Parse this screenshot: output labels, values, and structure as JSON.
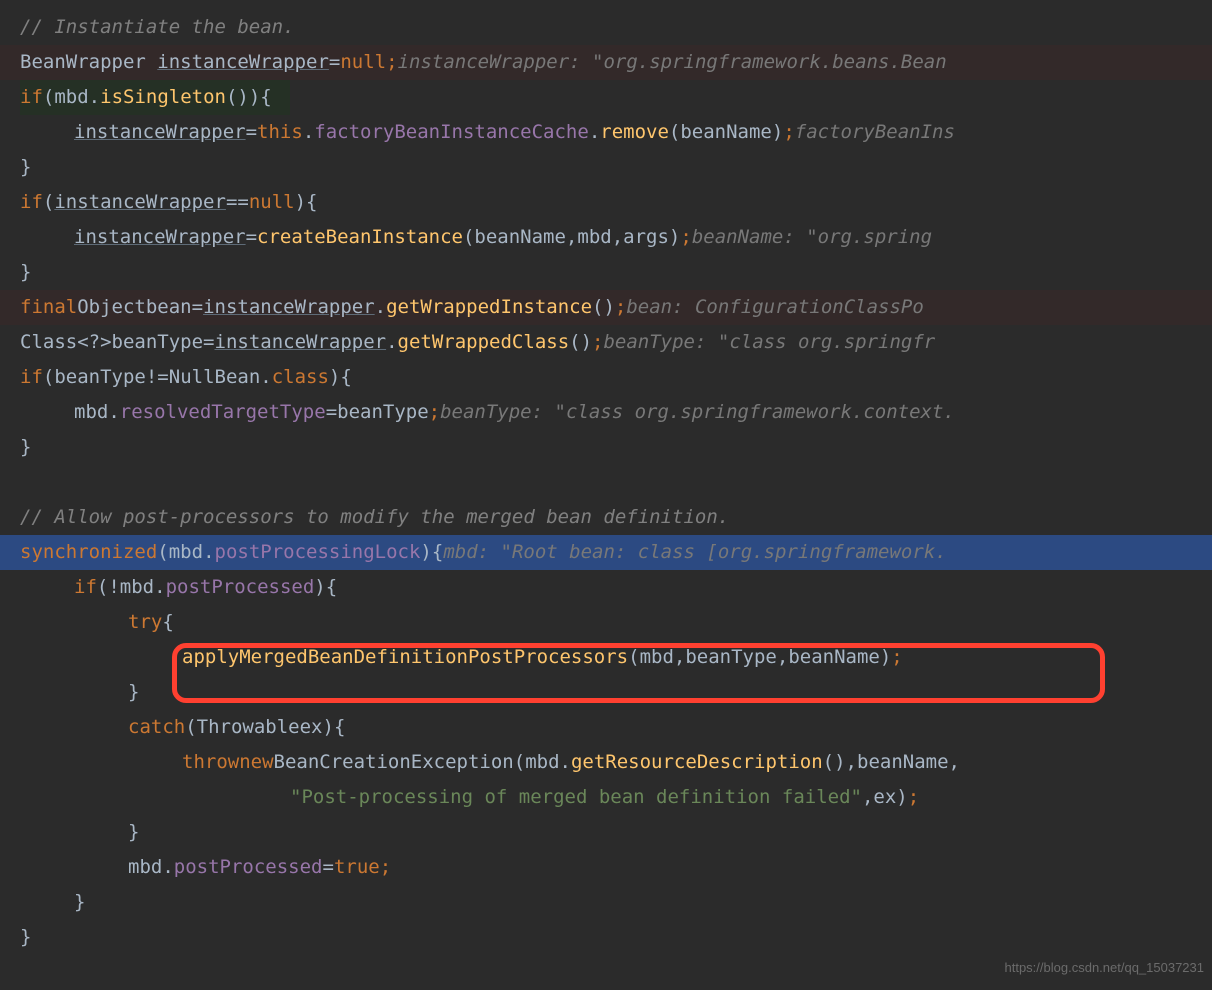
{
  "watermark": "https://blog.csdn.net/qq_15037231",
  "lines": {
    "l1": {
      "comment": "// Instantiate the bean."
    },
    "l2": {
      "type": "BeanWrapper",
      "var": "instanceWrapper",
      "eq": " = ",
      "null": "null",
      "semi": ";",
      "inlay": "   instanceWrapper: \"org.springframework.beans.Bean"
    },
    "l3": {
      "if": "if ",
      "po": "(",
      "obj": "mbd",
      "dot": ".",
      "method": "isSingleton",
      "pc": "()) ",
      "brace": "{"
    },
    "l4": {
      "var": "instanceWrapper",
      "eq": " = ",
      "this": "this",
      "dot": ".",
      "prop": "factoryBeanInstanceCache",
      "dot2": ".",
      "method": "remove",
      "po": "(",
      "arg": "beanName",
      "pc": ")",
      "semi": ";",
      "inlay": "   factoryBeanIns"
    },
    "l5": {
      "brace": "}"
    },
    "l6": {
      "if": "if ",
      "po": "(",
      "var": "instanceWrapper",
      "eq": " == ",
      "null": "null",
      "pc": ") ",
      "brace": "{"
    },
    "l7": {
      "var": "instanceWrapper",
      "eq": " = ",
      "method": "createBeanInstance",
      "po": "(",
      "arg1": "beanName",
      "c1": ", ",
      "arg2": "mbd",
      "c2": ", ",
      "arg3": "args",
      "pc": ")",
      "semi": ";",
      "inlay": "   beanName: \"org.spring"
    },
    "l8": {
      "brace": "}"
    },
    "l9": {
      "final": "final ",
      "type": "Object ",
      "var": "bean",
      "eq": " = ",
      "var2": "instanceWrapper",
      "dot": ".",
      "method": "getWrappedInstance",
      "pc": "()",
      "semi": ";",
      "inlay": "   bean: ConfigurationClassPo"
    },
    "l10": {
      "type": "Class",
      "gen": "<?> ",
      "var": "beanType",
      "eq": " = ",
      "var2": "instanceWrapper",
      "dot": ".",
      "method": "getWrappedClass",
      "pc": "()",
      "semi": ";",
      "inlay": "   beanType: \"class org.springfr"
    },
    "l11": {
      "if": "if ",
      "po": "(",
      "var": "beanType",
      "neq": " != ",
      "type": "NullBean",
      "dot": ".",
      "cls": "class",
      "pc": ") ",
      "brace": "{"
    },
    "l12": {
      "obj": "mbd",
      "dot": ".",
      "prop": "resolvedTargetType",
      "eq": " = ",
      "var": "beanType",
      "semi": ";",
      "inlay": "   beanType: \"class org.springframework.context."
    },
    "l13": {
      "brace": "}"
    },
    "l14": {
      "empty": ""
    },
    "l15": {
      "comment": "// Allow post-processors to modify the merged bean definition."
    },
    "l16": {
      "sync": "synchronized ",
      "po": "(",
      "obj": "mbd",
      "dot": ".",
      "prop": "postProcessingLock",
      "pc": ") ",
      "brace": "{",
      "inlay": "   mbd: \"Root bean: class [org.springframework."
    },
    "l17": {
      "if": "if ",
      "po": "(",
      "not": "!",
      "obj": "mbd",
      "dot": ".",
      "prop": "postProcessed",
      "pc": ") ",
      "brace": "{"
    },
    "l18": {
      "try": "try ",
      "brace": "{"
    },
    "l19": {
      "method": "applyMergedBeanDefinitionPostProcessors",
      "po": "(",
      "arg1": "mbd",
      "c1": ", ",
      "arg2": "beanType",
      "c2": ", ",
      "arg3": "beanName",
      "pc": ")",
      "semi": ";"
    },
    "l20": {
      "brace": "}"
    },
    "l21": {
      "catch": "catch ",
      "po": "(",
      "type": "Throwable ",
      "var": "ex",
      "pc": ") ",
      "brace": "{"
    },
    "l22": {
      "throw": "throw ",
      "new": "new ",
      "type": "BeanCreationException",
      "po": "(",
      "obj": "mbd",
      "dot": ".",
      "method": "getResourceDescription",
      "pc2": "()",
      "c1": ", ",
      "arg": "beanName",
      "c2": ","
    },
    "l23": {
      "str": "\"Post-processing of merged bean definition failed\"",
      "c": ", ",
      "var": "ex",
      "pc": ")",
      "semi": ";"
    },
    "l24": {
      "brace": "}"
    },
    "l25": {
      "obj": "mbd",
      "dot": ".",
      "prop": "postProcessed",
      "eq": " = ",
      "true": "true",
      "semi": ";"
    },
    "l26": {
      "brace": "}"
    },
    "l27": {
      "brace": "}"
    }
  }
}
